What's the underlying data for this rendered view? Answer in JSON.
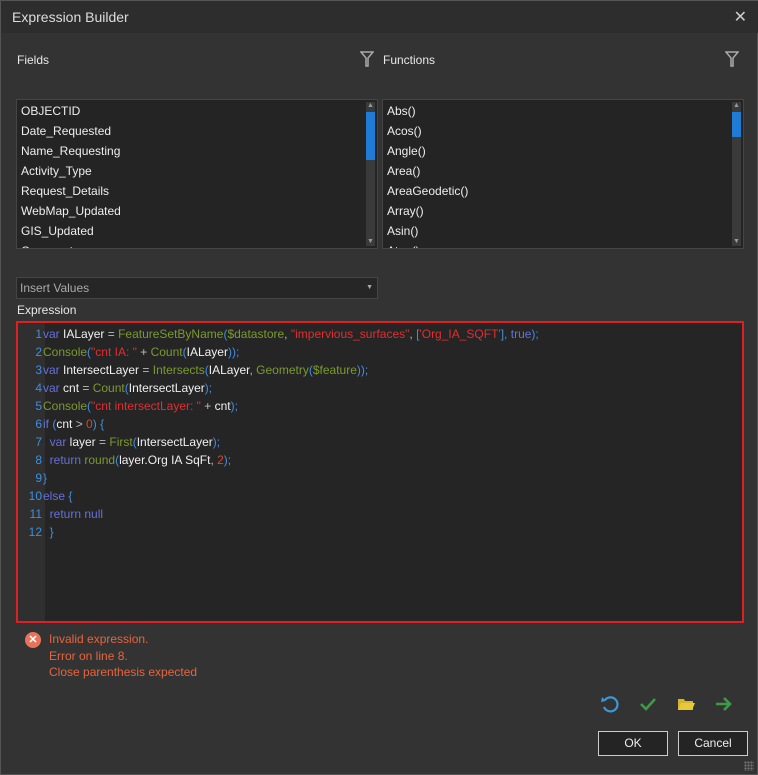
{
  "window": {
    "title": "Expression Builder",
    "close_icon": "close-icon"
  },
  "fields": {
    "label": "Fields",
    "items": [
      "OBJECTID",
      "Date_Requested",
      "Name_Requesting",
      "Activity_Type",
      "Request_Details",
      "WebMap_Updated",
      "GIS_Updated",
      "Comments"
    ]
  },
  "functions": {
    "label": "Functions",
    "items": [
      "Abs()",
      "Acos()",
      "Angle()",
      "Area()",
      "AreaGeodetic()",
      "Array()",
      "Asin()",
      "Atan()"
    ]
  },
  "insert_values": {
    "label": "Insert Values"
  },
  "expression": {
    "label": "Expression",
    "lines": [
      [
        {
          "t": "var ",
          "c": "k"
        },
        {
          "t": "IALayer",
          "c": "i"
        },
        {
          "t": " = ",
          "c": "o"
        },
        {
          "t": "FeatureSetByName",
          "c": "f"
        },
        {
          "t": "(",
          "c": "p"
        },
        {
          "t": "$datastore",
          "c": "f"
        },
        {
          "t": ", ",
          "c": "o"
        },
        {
          "t": "\"impervious_surfaces\"",
          "c": "s"
        },
        {
          "t": ", ",
          "c": "o"
        },
        {
          "t": "[",
          "c": "p"
        },
        {
          "t": "'Org_IA_SQFT'",
          "c": "s"
        },
        {
          "t": "], ",
          "c": "p"
        },
        {
          "t": "true",
          "c": "k"
        },
        {
          "t": ");",
          "c": "p"
        }
      ],
      [
        {
          "t": "Console",
          "c": "f"
        },
        {
          "t": "(",
          "c": "p"
        },
        {
          "t": "\"cnt IA: \"",
          "c": "s"
        },
        {
          "t": " + ",
          "c": "o"
        },
        {
          "t": "Count",
          "c": "f"
        },
        {
          "t": "(",
          "c": "p"
        },
        {
          "t": "IALayer",
          "c": "i"
        },
        {
          "t": "));",
          "c": "p"
        }
      ],
      [
        {
          "t": "var ",
          "c": "k"
        },
        {
          "t": "IntersectLayer",
          "c": "i"
        },
        {
          "t": " = ",
          "c": "o"
        },
        {
          "t": "Intersects",
          "c": "f"
        },
        {
          "t": "(",
          "c": "p"
        },
        {
          "t": "IALayer",
          "c": "i"
        },
        {
          "t": ", ",
          "c": "o"
        },
        {
          "t": "Geometry",
          "c": "f"
        },
        {
          "t": "(",
          "c": "p"
        },
        {
          "t": "$feature",
          "c": "f"
        },
        {
          "t": "));",
          "c": "p"
        }
      ],
      [
        {
          "t": "var ",
          "c": "k"
        },
        {
          "t": "cnt",
          "c": "i"
        },
        {
          "t": " = ",
          "c": "o"
        },
        {
          "t": "Count",
          "c": "f"
        },
        {
          "t": "(",
          "c": "p"
        },
        {
          "t": "IntersectLayer",
          "c": "i"
        },
        {
          "t": ");",
          "c": "p"
        }
      ],
      [
        {
          "t": "Console",
          "c": "f"
        },
        {
          "t": "(",
          "c": "p"
        },
        {
          "t": "\"cnt intersectLayer: \"",
          "c": "s"
        },
        {
          "t": " + ",
          "c": "o"
        },
        {
          "t": "cnt",
          "c": "i"
        },
        {
          "t": ");",
          "c": "p"
        }
      ],
      [
        {
          "t": "if ",
          "c": "k"
        },
        {
          "t": "(",
          "c": "p"
        },
        {
          "t": "cnt",
          "c": "i"
        },
        {
          "t": " > ",
          "c": "o"
        },
        {
          "t": "0",
          "c": "n"
        },
        {
          "t": ") {",
          "c": "p"
        }
      ],
      [
        {
          "t": "  var ",
          "c": "k"
        },
        {
          "t": "layer",
          "c": "i"
        },
        {
          "t": " = ",
          "c": "o"
        },
        {
          "t": "First",
          "c": "f"
        },
        {
          "t": "(",
          "c": "p"
        },
        {
          "t": "IntersectLayer",
          "c": "i"
        },
        {
          "t": ");",
          "c": "p"
        }
      ],
      [
        {
          "t": "  return ",
          "c": "k"
        },
        {
          "t": "round",
          "c": "f"
        },
        {
          "t": "(",
          "c": "p"
        },
        {
          "t": "layer.Org IA SqFt",
          "c": "i"
        },
        {
          "t": ", ",
          "c": "o"
        },
        {
          "t": "2",
          "c": "n"
        },
        {
          "t": ");",
          "c": "p"
        }
      ],
      [
        {
          "t": "}",
          "c": "p"
        }
      ],
      [
        {
          "t": "else ",
          "c": "k"
        },
        {
          "t": "{",
          "c": "p"
        }
      ],
      [
        {
          "t": "  return null",
          "c": "k"
        }
      ],
      [
        {
          "t": "  }",
          "c": "p"
        }
      ]
    ]
  },
  "error": {
    "lines": [
      "Invalid expression.",
      "Error on line 8.",
      "Close parenthesis expected"
    ]
  },
  "buttons": {
    "ok": "OK",
    "cancel": "Cancel"
  },
  "colors": {
    "error": "#e8643c",
    "accent": "#1e7bd6",
    "border_error": "#e02020"
  }
}
